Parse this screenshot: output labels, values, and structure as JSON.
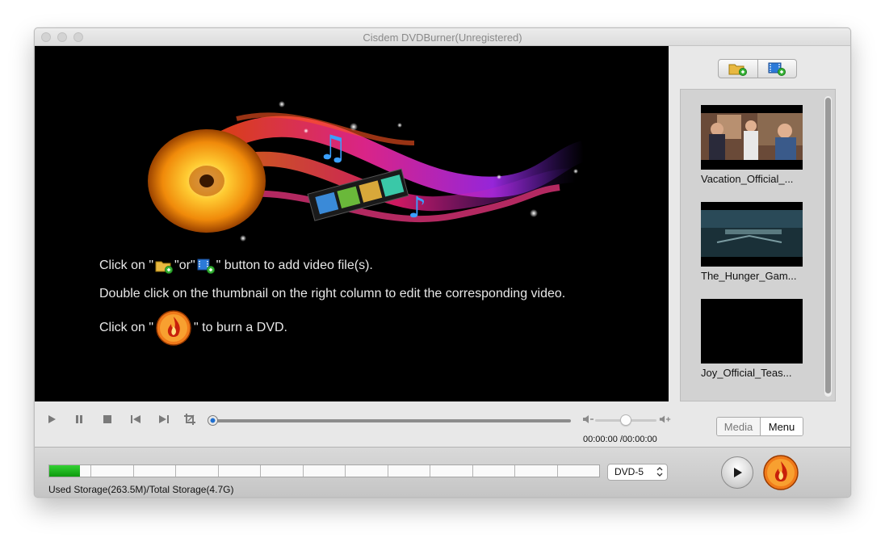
{
  "window": {
    "title": "Cisdem DVDBurner(Unregistered)"
  },
  "instructions": {
    "line1_pre": "Click on \"",
    "line1_mid": "\"or\"",
    "line1_post": "\" button to add video file(s).",
    "line2": "Double click on the thumbnail on the right column to edit the corresponding video.",
    "line3_pre": "Click on  \"",
    "line3_post": "\"  to burn a DVD."
  },
  "sidebar": {
    "videos": [
      {
        "label": "Vacation_Official_..."
      },
      {
        "label": "The_Hunger_Gam..."
      },
      {
        "label": "Joy_Official_Teas..."
      }
    ]
  },
  "player": {
    "time": "00:00:00 /00:00:00",
    "progress": 0,
    "volume": 0.5
  },
  "mode_tabs": {
    "media": "Media",
    "menu": "Menu",
    "selected": "Menu"
  },
  "storage": {
    "label": "Used Storage(263.5M)/Total Storage(4.7G)",
    "used_fraction": 0.056,
    "segments": 13
  },
  "disc": {
    "selected": "DVD-5"
  },
  "colors": {
    "storage_fill": "#1bb51b",
    "burn_accent": "#e8471a"
  },
  "icons": [
    "add-folder-icon",
    "add-video-icon",
    "play-icon",
    "pause-icon",
    "stop-icon",
    "previous-icon",
    "next-icon",
    "crop-icon",
    "volume-down-icon",
    "volume-up-icon",
    "burn-icon"
  ]
}
